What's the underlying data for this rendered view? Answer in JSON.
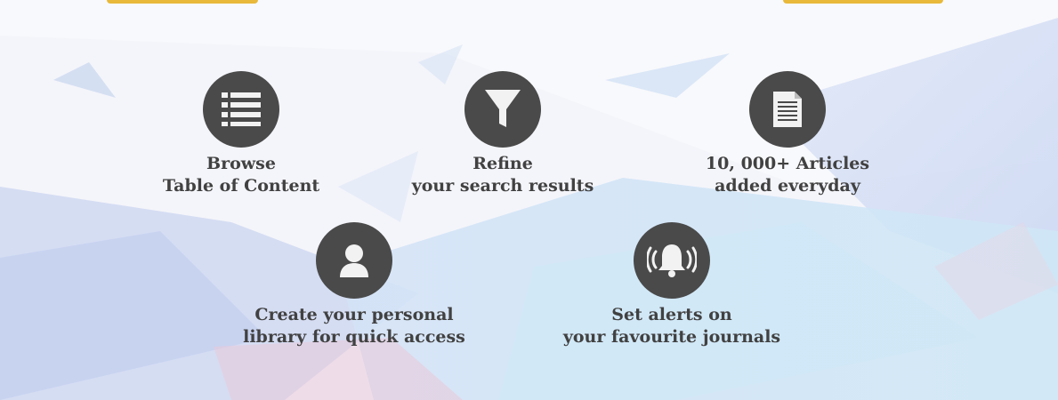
{
  "colors": {
    "icon_circle": "#4a4a4a",
    "text": "#414141",
    "accent_strip": "#e8b93a",
    "background_base": "#f3f5fb"
  },
  "features": [
    {
      "icon": "list-icon",
      "line1": "Browse",
      "line2": "Table of Content"
    },
    {
      "icon": "funnel-filter-icon",
      "line1": "Refine",
      "line2": "your search results"
    },
    {
      "icon": "document-icon",
      "line1": "10, 000+ Articles",
      "line2": "added everyday"
    },
    {
      "icon": "user-icon",
      "line1": "Create your personal",
      "line2": "library for quick access"
    },
    {
      "icon": "bell-alert-icon",
      "line1": "Set alerts on",
      "line2": "your favourite journals"
    }
  ]
}
